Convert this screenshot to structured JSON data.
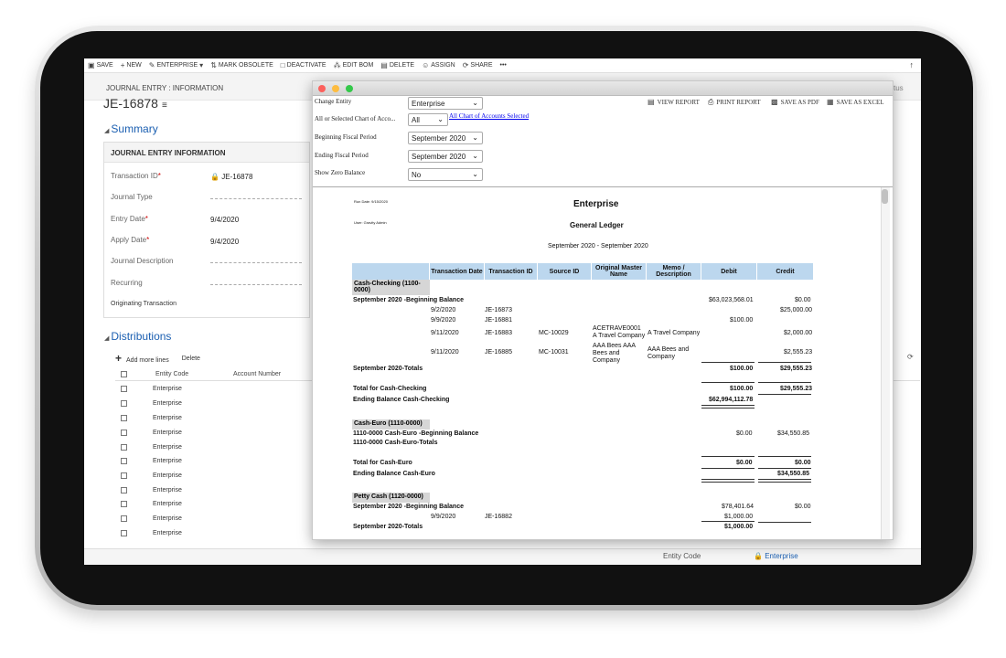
{
  "toolbar": {
    "items": [
      {
        "icon": "save-icon",
        "label": "SAVE"
      },
      {
        "icon": "plus-icon",
        "label": "NEW"
      },
      {
        "icon": "enterprise-icon",
        "label": "ENTERPRISE"
      },
      {
        "icon": "obsolete-icon",
        "label": "MARK OBSOLETE"
      },
      {
        "icon": "deactivate-icon",
        "label": "DEACTIVATE"
      },
      {
        "icon": "edit-bom-icon",
        "label": "EDIT BOM"
      },
      {
        "icon": "trash-icon",
        "label": "DELETE"
      },
      {
        "icon": "assign-icon",
        "label": "ASSIGN"
      },
      {
        "icon": "share-icon",
        "label": "SHARE"
      }
    ],
    "more": "•••",
    "up": "↑"
  },
  "header": {
    "breadcrumb": "JOURNAL ENTRY : INFORMATION",
    "title": "JE-16878",
    "right_ghost": "tus"
  },
  "summary": {
    "title": "Summary",
    "panel_title": "JOURNAL ENTRY INFORMATION",
    "fields": {
      "transaction_id_label": "Transaction ID",
      "transaction_id_value": "JE-16878",
      "journal_type_label": "Journal Type",
      "entry_date_label": "Entry Date",
      "entry_date_value": "9/4/2020",
      "apply_date_label": "Apply Date",
      "apply_date_value": "9/4/2020",
      "journal_description_label": "Journal Description",
      "recurring_label": "Recurring",
      "originating_label": "Originating Transaction"
    }
  },
  "distributions": {
    "title": "Distributions",
    "add_label": "Add more lines",
    "delete_label": "Delete",
    "columns": [
      "Entity Code",
      "Account Number"
    ],
    "rows": [
      "Enterprise",
      "Enterprise",
      "Enterprise",
      "Enterprise",
      "Enterprise",
      "Enterprise",
      "Enterprise",
      "Enterprise",
      "Enterprise",
      "Enterprise",
      "Enterprise"
    ]
  },
  "footer": {
    "entity_code_label": "Entity Code",
    "entity_code_value": "Enterprise"
  },
  "report_window": {
    "options": {
      "change_entity_label": "Change Entity",
      "change_entity_value": "Enterprise",
      "chart_accounts_label": "All or Selected Chart of Acco...",
      "chart_accounts_value": "All",
      "chart_accounts_link": "All Chart of Accounts Selected",
      "beginning_period_label": "Beginning Fiscal Period",
      "beginning_period_value": "September 2020",
      "ending_period_label": "Ending Fiscal Period",
      "ending_period_value": "September 2020",
      "show_zero_label": "Show Zero Balance",
      "show_zero_value": "No"
    },
    "actions": {
      "view_report": "VIEW REPORT",
      "print_report": "PRINT REPORT",
      "save_pdf": "SAVE AS PDF",
      "save_excel": "SAVE AS EXCEL"
    },
    "colors": {
      "close": "#fc605c",
      "minimize": "#fdbc40",
      "zoom": "#34c84a",
      "header_fill": "#bcd7ee"
    }
  },
  "report": {
    "run_date": "Run Date: 9/15/2020",
    "user": "User: Gravity Admin",
    "company": "Enterprise",
    "title": "General Ledger",
    "period": "September 2020 - September 2020",
    "columns": [
      "Transaction Date",
      "Transaction ID",
      "Source ID",
      "Original Master Name",
      "Memo / Description",
      "Debit",
      "Credit"
    ],
    "cash_checking": {
      "group": "Cash-Checking (1100-0000)",
      "beginning": "September 2020 -Beginning Balance",
      "beginning_debit": "$63,023,568.01",
      "beginning_credit": "$0.00",
      "rows": [
        {
          "date": "9/2/2020",
          "id": "JE-16873",
          "source": "",
          "name": "",
          "memo": "",
          "debit": "",
          "credit": "$25,000.00"
        },
        {
          "date": "9/9/2020",
          "id": "JE-16881",
          "source": "",
          "name": "",
          "memo": "",
          "debit": "$100.00",
          "credit": ""
        },
        {
          "date": "9/11/2020",
          "id": "JE-16883",
          "source": "MC-10029",
          "name": "ACETRAVE0001 A Travel Company",
          "memo": "A Travel Company",
          "debit": "",
          "credit": "$2,000.00"
        },
        {
          "date": "9/11/2020",
          "id": "JE-16885",
          "source": "MC-10031",
          "name": "AAA Bees AAA Bees and Company",
          "memo": "AAA Bees and Company",
          "debit": "",
          "credit": "$2,555.23"
        }
      ],
      "totals_label": "September 2020-Totals",
      "totals_debit": "$100.00",
      "totals_credit": "$29,555.23",
      "account_total_label": "Total for Cash-Checking",
      "account_total_debit": "$100.00",
      "account_total_credit": "$29,555.23",
      "ending_label": "Ending Balance Cash-Checking",
      "ending_debit": "$62,994,112.78"
    },
    "cash_euro": {
      "group": "Cash-Euro (1110-0000)",
      "beginning": "1110-0000 Cash-Euro -Beginning Balance",
      "beginning_debit": "$0.00",
      "beginning_credit": "$34,550.85",
      "totals_label": "1110-0000 Cash-Euro-Totals",
      "account_total_label": "Total for Cash-Euro",
      "account_total_debit": "$0.00",
      "account_total_credit": "$0.00",
      "ending_label": "Ending Balance Cash-Euro",
      "ending_credit": "$34,550.85"
    },
    "petty_cash": {
      "group": "Petty Cash (1120-0000)",
      "beginning": "September 2020 -Beginning Balance",
      "beginning_debit": "$78,401.64",
      "beginning_credit": "$0.00",
      "row_date": "9/9/2020",
      "row_id": "JE-16882",
      "row_debit": "$1,000.00",
      "totals_label": "September 2020-Totals",
      "totals_debit": "$1,000.00"
    }
  }
}
